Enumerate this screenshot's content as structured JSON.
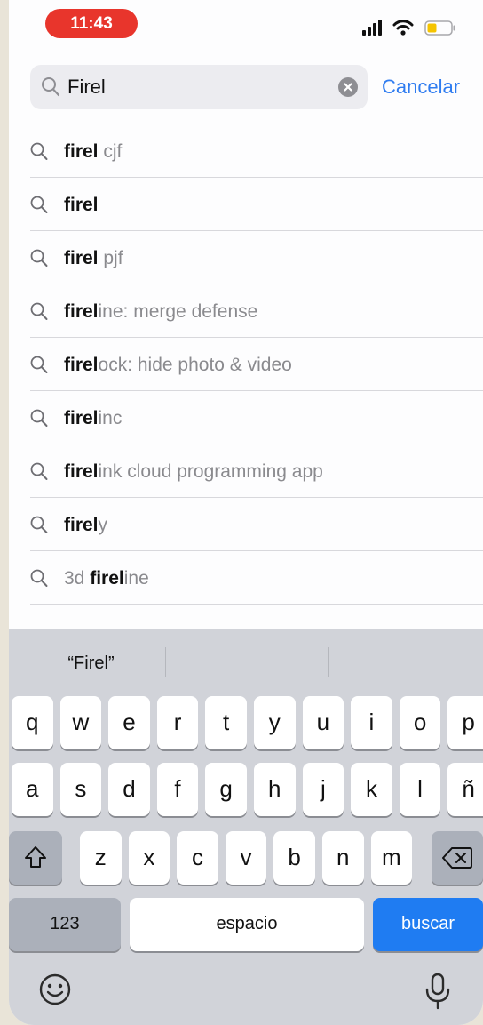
{
  "status_bar": {
    "time": "11:43"
  },
  "search": {
    "value": "Firel",
    "cancel_label": "Cancelar"
  },
  "suggestions": [
    {
      "match": "firel",
      "rest": " cjf"
    },
    {
      "match": "firel",
      "rest": ""
    },
    {
      "match": "firel",
      "rest": " pjf"
    },
    {
      "match": "firel",
      "rest": "ine: merge defense"
    },
    {
      "match": "firel",
      "rest": "ock: hide photo & video"
    },
    {
      "match": "firel",
      "rest": "inc"
    },
    {
      "match": "firel",
      "rest": "ink cloud programming app"
    },
    {
      "match": "firel",
      "rest": "y"
    },
    {
      "prefix": "3d ",
      "match": "firel",
      "rest": "ine"
    }
  ],
  "keyboard": {
    "prediction": "“Firel”",
    "row1": [
      "q",
      "w",
      "e",
      "r",
      "t",
      "y",
      "u",
      "i",
      "o",
      "p"
    ],
    "row2": [
      "a",
      "s",
      "d",
      "f",
      "g",
      "h",
      "j",
      "k",
      "l",
      "ñ"
    ],
    "row3": [
      "z",
      "x",
      "c",
      "v",
      "b",
      "n",
      "m"
    ],
    "numbers_label": "123",
    "space_label": "espacio",
    "return_label": "buscar"
  },
  "icons": {
    "status": [
      "signal-icon",
      "wifi-icon",
      "battery-icon"
    ],
    "search": "search-icon",
    "clear": "clear-icon",
    "shift": "shift-icon",
    "delete": "delete-icon",
    "emoji": "emoji-icon",
    "mic": "microphone-icon"
  },
  "colors": {
    "accent": "#2f7cf0",
    "time_pill": "#e8352c",
    "return_key": "#1f7cf2",
    "battery_fill": "#f5c400"
  }
}
